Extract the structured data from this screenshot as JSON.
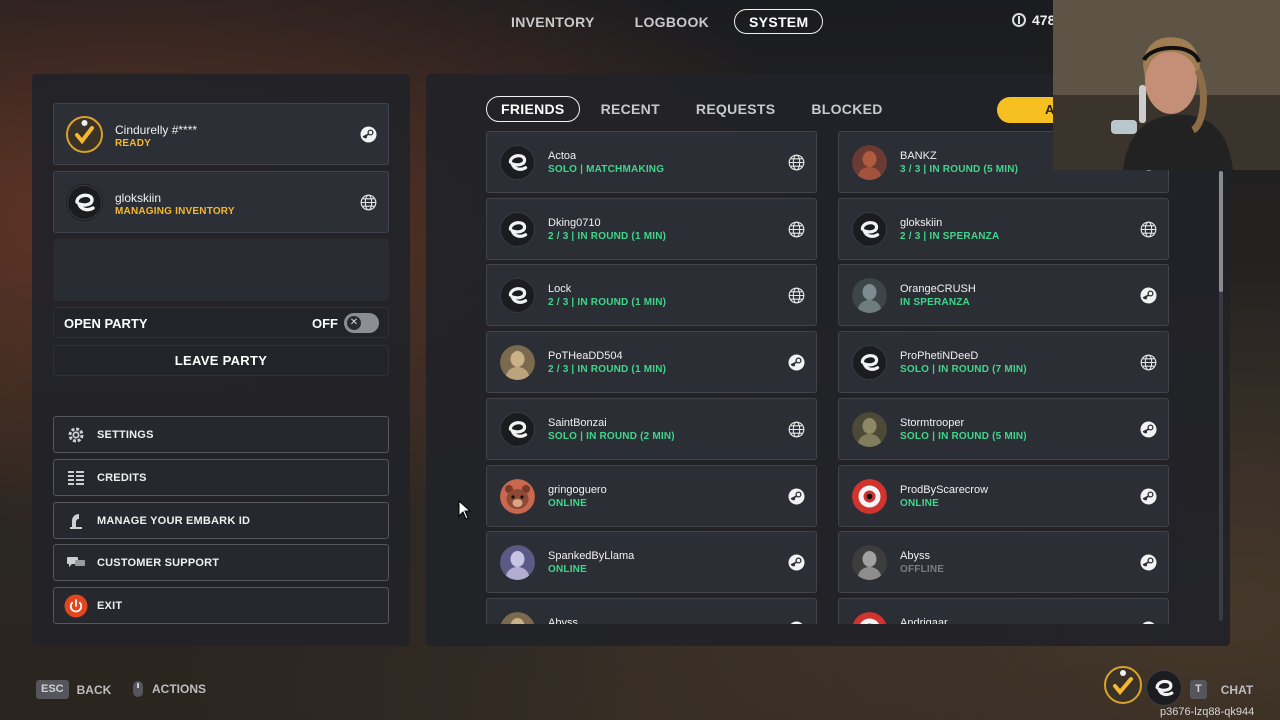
{
  "topnav": {
    "tabs": [
      {
        "label": "INVENTORY",
        "active": false
      },
      {
        "label": "LOGBOOK",
        "active": false
      },
      {
        "label": "SYSTEM",
        "active": true
      }
    ],
    "currency_value": "478"
  },
  "party": {
    "members": [
      {
        "name": "Cindurelly #****",
        "status": "READY",
        "avatar": "checkmark-badge-avatar",
        "platform_icon": "steam-icon"
      },
      {
        "name": "glokskiin",
        "status": "MANAGING INVENTORY",
        "avatar": "embark-logo-avatar",
        "platform_icon": "globe-icon"
      }
    ],
    "open_party_label": "OPEN PARTY",
    "open_party_state": "OFF",
    "leave_party_label": "LEAVE PARTY"
  },
  "menu": [
    {
      "label": "SETTINGS",
      "icon": "gear-icon"
    },
    {
      "label": "CREDITS",
      "icon": "credits-icon"
    },
    {
      "label": "MANAGE YOUR EMBARK ID",
      "icon": "id-icon"
    },
    {
      "label": "CUSTOMER SUPPORT",
      "icon": "chat-bubbles-icon"
    },
    {
      "label": "EXIT",
      "icon": "power-icon"
    }
  ],
  "friends_tabs": [
    {
      "label": "FRIENDS",
      "active": true
    },
    {
      "label": "RECENT",
      "active": false
    },
    {
      "label": "REQUESTS",
      "active": false
    },
    {
      "label": "BLOCKED",
      "active": false
    }
  ],
  "add_button_label": "A",
  "friends": [
    {
      "name": "Actoa",
      "status": "SOLO | MATCHMAKING",
      "status_type": "ingame",
      "avatar": "embark",
      "platform": "globe-icon"
    },
    {
      "name": "BANKZ",
      "status": "3 / 3 | IN ROUND (5 MIN)",
      "status_type": "ingame",
      "avatar": "photo-red",
      "platform": "steam-icon"
    },
    {
      "name": "Dking0710",
      "status": "2 / 3 | IN ROUND (1 MIN)",
      "status_type": "ingame",
      "avatar": "embark",
      "platform": "globe-icon"
    },
    {
      "name": "glokskiin",
      "status": "2 / 3 | IN SPERANZA",
      "status_type": "ingame",
      "avatar": "embark",
      "platform": "globe-icon"
    },
    {
      "name": "Lock",
      "status": "2 / 3 | IN ROUND (1 MIN)",
      "status_type": "ingame",
      "avatar": "embark",
      "platform": "globe-icon"
    },
    {
      "name": "OrangeCRUSH",
      "status": "IN SPERANZA",
      "status_type": "ingame",
      "avatar": "photo-dark",
      "platform": "steam-icon"
    },
    {
      "name": "PoTHeaDD504",
      "status": "2 / 3 | IN ROUND (1 MIN)",
      "status_type": "ingame",
      "avatar": "photo-tan",
      "platform": "steam-icon"
    },
    {
      "name": "ProPhetiNDeeD",
      "status": "SOLO | IN ROUND (7 MIN)",
      "status_type": "ingame",
      "avatar": "embark",
      "platform": "globe-icon"
    },
    {
      "name": "SaintBonzai",
      "status": "SOLO | IN ROUND (2 MIN)",
      "status_type": "ingame",
      "avatar": "embark",
      "platform": "globe-icon"
    },
    {
      "name": "Stormtrooper",
      "status": "SOLO | IN ROUND (5 MIN)",
      "status_type": "ingame",
      "avatar": "photo-olive",
      "platform": "steam-icon"
    },
    {
      "name": "gringoguero",
      "status": "ONLINE",
      "status_type": "online",
      "avatar": "bear",
      "platform": "steam-icon"
    },
    {
      "name": "ProdByScarecrow",
      "status": "ONLINE",
      "status_type": "online",
      "avatar": "eye-red",
      "platform": "steam-icon"
    },
    {
      "name": "SpankedByLlama",
      "status": "ONLINE",
      "status_type": "online",
      "avatar": "photo-purple",
      "platform": "steam-icon"
    },
    {
      "name": "Abyss",
      "status": "OFFLINE",
      "status_type": "offline",
      "avatar": "photo-gray",
      "platform": "steam-icon"
    },
    {
      "name": "Abyss",
      "status": "",
      "status_type": "offline",
      "avatar": "photo-tan",
      "platform": "steam-icon"
    },
    {
      "name": "Andrigaar",
      "status": "",
      "status_type": "offline",
      "avatar": "eye-red",
      "platform": "steam-icon"
    }
  ],
  "colors": {
    "ready": "#f5b82e",
    "ingame": "#3fd68a",
    "online": "#3fd68a",
    "offline": "#7c7d82",
    "accent": "#f6c022",
    "exit": "#e3451f"
  },
  "bottom": {
    "back_key": "ESC",
    "back_label": "BACK",
    "actions_label": "ACTIONS",
    "chat_key": "T",
    "chat_label": "CHAT",
    "player_id": "p3676-lzq88-qk944"
  }
}
